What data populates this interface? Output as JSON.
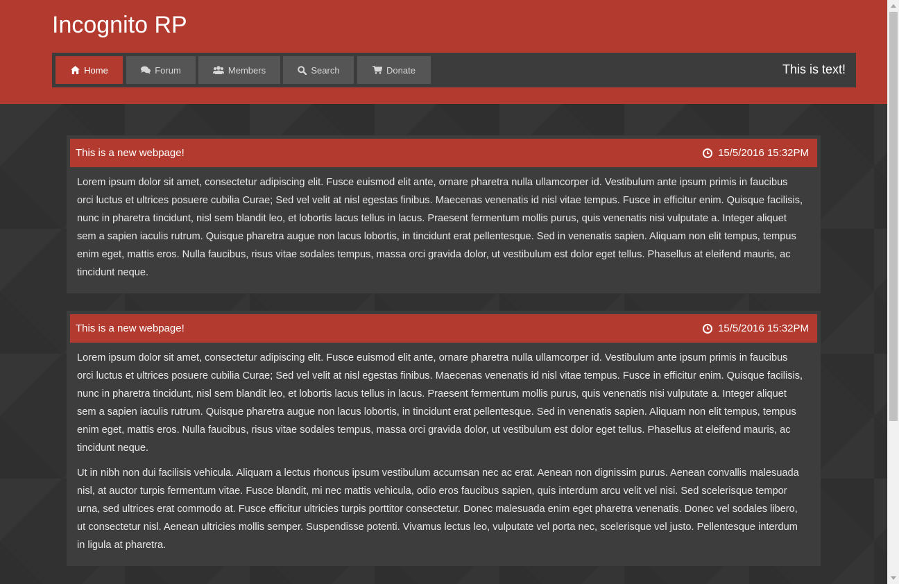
{
  "site": {
    "title": "Incognito RP"
  },
  "nav": {
    "items": [
      {
        "label": "Home",
        "icon": "home-icon",
        "active": true
      },
      {
        "label": "Forum",
        "icon": "comments-icon",
        "active": false
      },
      {
        "label": "Members",
        "icon": "users-icon",
        "active": false
      },
      {
        "label": "Search",
        "icon": "search-icon",
        "active": false
      },
      {
        "label": "Donate",
        "icon": "cart-icon",
        "active": false
      }
    ],
    "right_text": "This is text!"
  },
  "colors": {
    "accent": "#b33a2e",
    "nav_bg": "#3c3c3c",
    "nav_item_bg": "#555555",
    "card_bg": "#3d3d3d",
    "page_bg": "#313131"
  },
  "posts": [
    {
      "title": "This is a new webpage!",
      "date": "15/5/2016 15:32PM",
      "paragraphs": [
        "Lorem ipsum dolor sit amet, consectetur adipiscing elit. Fusce euismod elit ante, ornare pharetra nulla ullamcorper id. Vestibulum ante ipsum primis in faucibus orci luctus et ultrices posuere cubilia Curae; Sed vel velit at nisl egestas finibus. Maecenas venenatis id nisl vitae tempus. Fusce in efficitur enim. Quisque facilisis, nunc in pharetra tincidunt, nisl sem blandit leo, et lobortis lacus tellus in lacus. Praesent fermentum mollis purus, quis venenatis nisi vulputate a. Integer aliquet sem a sapien iaculis rutrum. Quisque pharetra augue non lacus lobortis, in tincidunt erat pellentesque. Sed in venenatis sapien. Aliquam non elit tempus, tempus enim eget, mattis eros. Nulla faucibus, risus vitae sodales tempus, massa orci gravida dolor, ut vestibulum est dolor eget tellus. Phasellus at eleifend mauris, ac tincidunt neque."
      ]
    },
    {
      "title": "This is a new webpage!",
      "date": "15/5/2016 15:32PM",
      "paragraphs": [
        "Lorem ipsum dolor sit amet, consectetur adipiscing elit. Fusce euismod elit ante, ornare pharetra nulla ullamcorper id. Vestibulum ante ipsum primis in faucibus orci luctus et ultrices posuere cubilia Curae; Sed vel velit at nisl egestas finibus. Maecenas venenatis id nisl vitae tempus. Fusce in efficitur enim. Quisque facilisis, nunc in pharetra tincidunt, nisl sem blandit leo, et lobortis lacus tellus in lacus. Praesent fermentum mollis purus, quis venenatis nisi vulputate a. Integer aliquet sem a sapien iaculis rutrum. Quisque pharetra augue non lacus lobortis, in tincidunt erat pellentesque. Sed in venenatis sapien. Aliquam non elit tempus, tempus enim eget, mattis eros. Nulla faucibus, risus vitae sodales tempus, massa orci gravida dolor, ut vestibulum est dolor eget tellus. Phasellus at eleifend mauris, ac tincidunt neque.",
        "Ut in nibh non dui facilisis vehicula. Aliquam a lectus rhoncus ipsum vestibulum accumsan nec ac erat. Aenean non dignissim purus. Aenean convallis malesuada nisl, at auctor turpis fermentum vitae. Fusce blandit, mi nec mattis vehicula, odio eros faucibus sapien, quis interdum arcu velit vel nisi. Sed scelerisque tempor urna, sed ultrices erat commodo at. Fusce efficitur ultricies turpis porttitor consectetur. Donec malesuada enim eget pharetra venenatis. Donec vel sodales libero, ut consectetur nisl. Aenean ultricies mollis semper. Suspendisse potenti. Vivamus lectus leo, vulputate vel porta nec, scelerisque vel justo. Pellentesque interdum in ligula at pharetra."
      ]
    }
  ]
}
